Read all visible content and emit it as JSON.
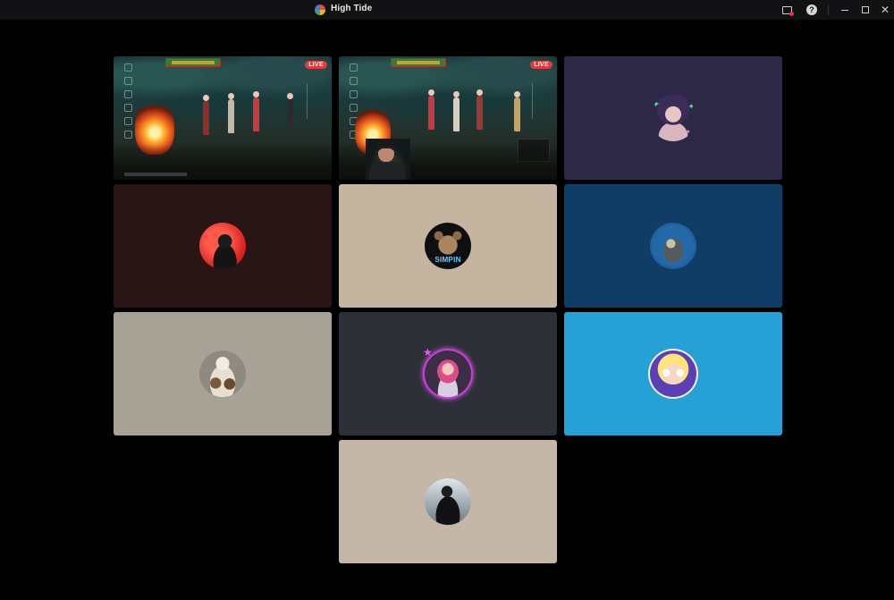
{
  "window": {
    "title": "High Tide",
    "help_glyph": "?",
    "close_glyph": "✕"
  },
  "icons": {
    "app": "app-logo-icon",
    "screen_share": "screen-share-icon",
    "help": "help-icon",
    "minimize": "minimize-icon",
    "maximize": "maximize-icon",
    "close": "close-icon"
  },
  "tiles": [
    {
      "kind": "stream",
      "live_label": "LIVE"
    },
    {
      "kind": "stream",
      "live_label": "LIVE"
    },
    {
      "kind": "avatar",
      "background": "#2e2847",
      "avatar": "purple-hair-character"
    },
    {
      "kind": "avatar",
      "background": "#281616",
      "avatar": "person-red-background"
    },
    {
      "kind": "avatar",
      "background": "#c4b4a0",
      "avatar": "teddy-bear-simpin",
      "avatar_text": "SIMPIN"
    },
    {
      "kind": "avatar",
      "background": "#0f3d66",
      "avatar": "armored-robot"
    },
    {
      "kind": "avatar",
      "background": "#a8a296",
      "avatar": "dog"
    },
    {
      "kind": "avatar",
      "background": "#2e3038",
      "avatar": "pink-hair-girl",
      "ring_color": "#c93dd9"
    },
    {
      "kind": "avatar",
      "background": "#26a1d6",
      "avatar": "powerpuff-bubbles"
    },
    {
      "kind": "avatar",
      "background": "#c4b6a8",
      "avatar": "person-dark-hoodie"
    }
  ]
}
